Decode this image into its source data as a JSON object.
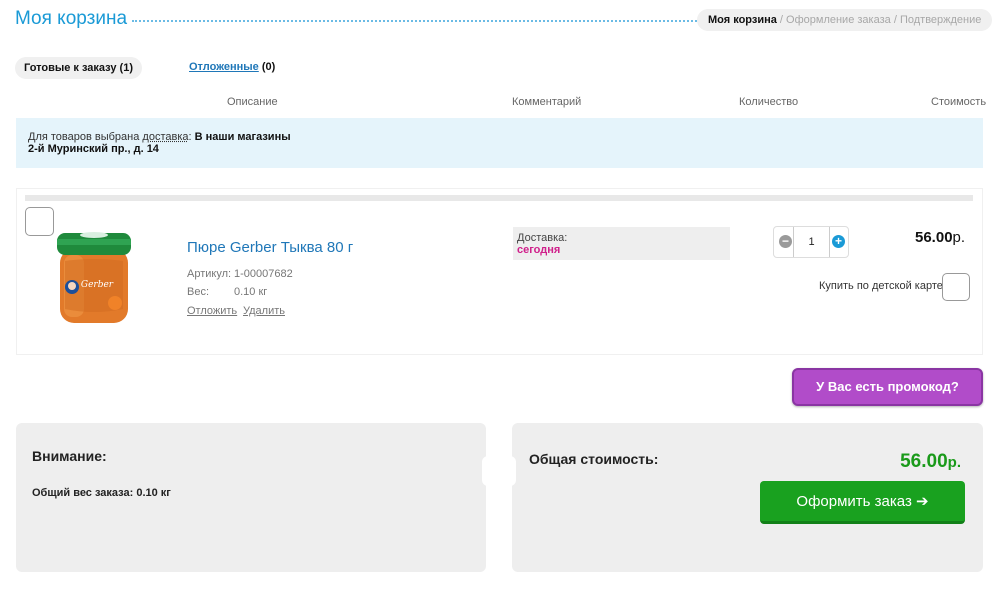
{
  "header": {
    "title": "Моя корзина",
    "steps": [
      {
        "label": "Моя корзина"
      },
      {
        "label": "Оформление заказа"
      },
      {
        "label": "Подтверждение"
      }
    ],
    "step_separator": "/"
  },
  "tabs": {
    "ready_label": "Готовые к заказу (1)",
    "deferred_label": "Отложенные",
    "deferred_count": "(0)"
  },
  "columns": {
    "description": "Описание",
    "comment": "Комментарий",
    "quantity": "Количество",
    "cost": "Стоимость"
  },
  "delivery": {
    "prefix": "Для товаров выбрана ",
    "link": "доставка",
    "colon": ":",
    "method": "В наши магазины",
    "address": "2-й Муринский пр., д. 14"
  },
  "item": {
    "name": "Пюре Gerber Тыква 80 г",
    "article_label": "Артикул:",
    "article": "1-00007682",
    "weight_label": "Вес:",
    "weight": "0.10 кг",
    "defer_action": "Отложить",
    "delete_action": "Удалить",
    "comment_label": "Доставка:",
    "comment_value": "сегодня",
    "quantity": "1",
    "price": "56.00",
    "currency": "р.",
    "child_card_label": "Купить по детской карте",
    "image_brand": "Gerber"
  },
  "promo": {
    "label": "У Вас есть промокод?"
  },
  "notice": {
    "title": "Внимание:",
    "weight_text": "Общий вес заказа: 0.10 кг"
  },
  "summary": {
    "total_label": "Общая стоимость:",
    "total_value": "56.00",
    "currency": "р.",
    "checkout_label": "Оформить заказ ➔"
  },
  "colors": {
    "accent_blue": "#1a9ad6",
    "promo_purple": "#b14cc9",
    "checkout_green": "#19a11f",
    "total_green": "#1a9a1a",
    "highlight_pink": "#d0208b"
  }
}
